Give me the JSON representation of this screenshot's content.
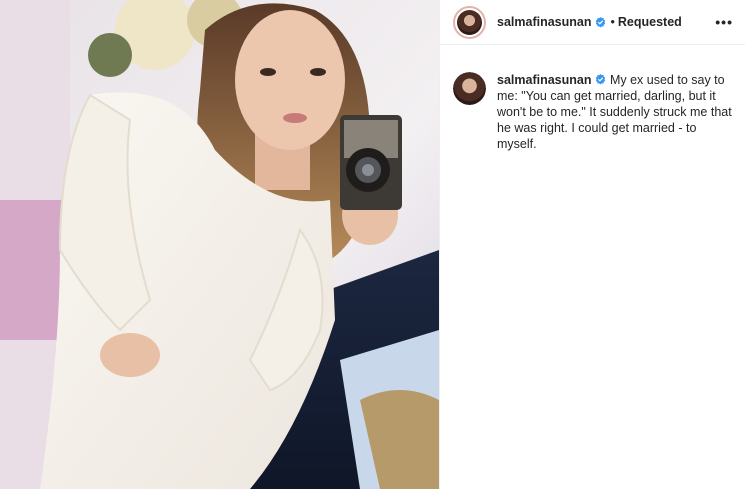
{
  "post": {
    "author": {
      "username": "salmafinasunan",
      "verified": true,
      "avatar_icon": "profile-avatar"
    },
    "header": {
      "separator": "•",
      "follow_status": "Requested",
      "more_label": "•••"
    },
    "caption": {
      "username": "salmafinasunan",
      "text": "My ex used to say to me: \"You can get married, darling, but it won't be to me.\" It suddenly struck me that he was right. I could get married - to myself."
    },
    "colors": {
      "verified_badge": "#3897f0",
      "text": "#262626",
      "avatar_ring": "#e2b3a6"
    }
  }
}
